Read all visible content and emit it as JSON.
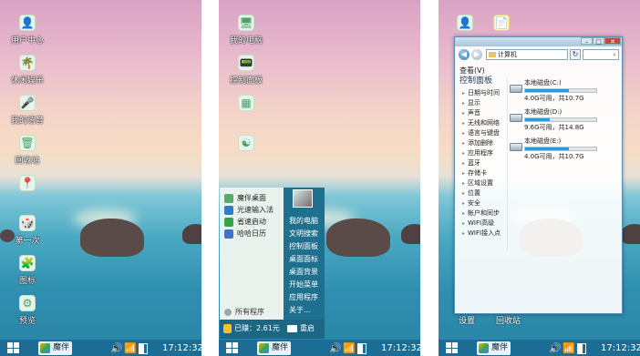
{
  "taskbar": {
    "app_label": "魔伴",
    "time": "17:12:32"
  },
  "panel1": {
    "icons": [
      {
        "label": "用户中心",
        "glyph": "👤"
      },
      {
        "label": "休闲娱乐",
        "glyph": "🌴"
      },
      {
        "label": "我的语音",
        "glyph": "🎤"
      },
      {
        "label": "回收站",
        "glyph": "🗑"
      },
      {
        "label": "",
        "glyph": "📍"
      },
      {
        "label": "第一次",
        "glyph": "🎲"
      },
      {
        "label": "图标",
        "glyph": "🧩"
      },
      {
        "label": "预览",
        "glyph": "⚙"
      }
    ]
  },
  "panel2": {
    "icons": [
      {
        "label": "我的电脑",
        "glyph": "🖥"
      },
      {
        "label": "控制面板",
        "glyph": "📟"
      },
      {
        "label": "",
        "glyph": "▦"
      },
      {
        "label": "",
        "glyph": "☯"
      }
    ],
    "start_menu": {
      "left_items": [
        "魔伴桌面",
        "光速输入法",
        "省速启动",
        "哈哈日历"
      ],
      "all_programs": "所有程序",
      "right_items": [
        "我的电脑",
        "文明搜索",
        "控制面板",
        "桌面面标",
        "桌面背景",
        "开始菜单",
        "应用程序",
        "关于..."
      ],
      "score": "已赚：2.61元",
      "restart": "重启"
    }
  },
  "panel3": {
    "top_icons": [
      {
        "glyph": "👤"
      },
      {
        "glyph": "📄"
      }
    ],
    "window": {
      "address": "计算机",
      "menu_view": "查看(V)",
      "sidebar_title": "控制面板",
      "sidebar_items": [
        "日期与时间",
        "显示",
        "声音",
        "无线和网络",
        "语言与键盘",
        "添加删除",
        "应用程序",
        "蓝牙",
        "存储卡",
        "区域设置",
        "位置",
        "安全",
        "帐户和同步",
        "WIFI高级",
        "WIFI接入点"
      ],
      "drives": [
        {
          "name": "本地磁盘(C:)",
          "info": "4.0G可用，共10.7G",
          "used_fraction": 0.62
        },
        {
          "name": "本地磁盘(D:)",
          "info": "9.6G可用，共14.8G",
          "used_fraction": 0.35
        },
        {
          "name": "本地磁盘(E:)",
          "info": "4.0G可用，共10.7G",
          "used_fraction": 0.62
        }
      ]
    },
    "bottom_labels": [
      "设置",
      "回收站"
    ]
  }
}
